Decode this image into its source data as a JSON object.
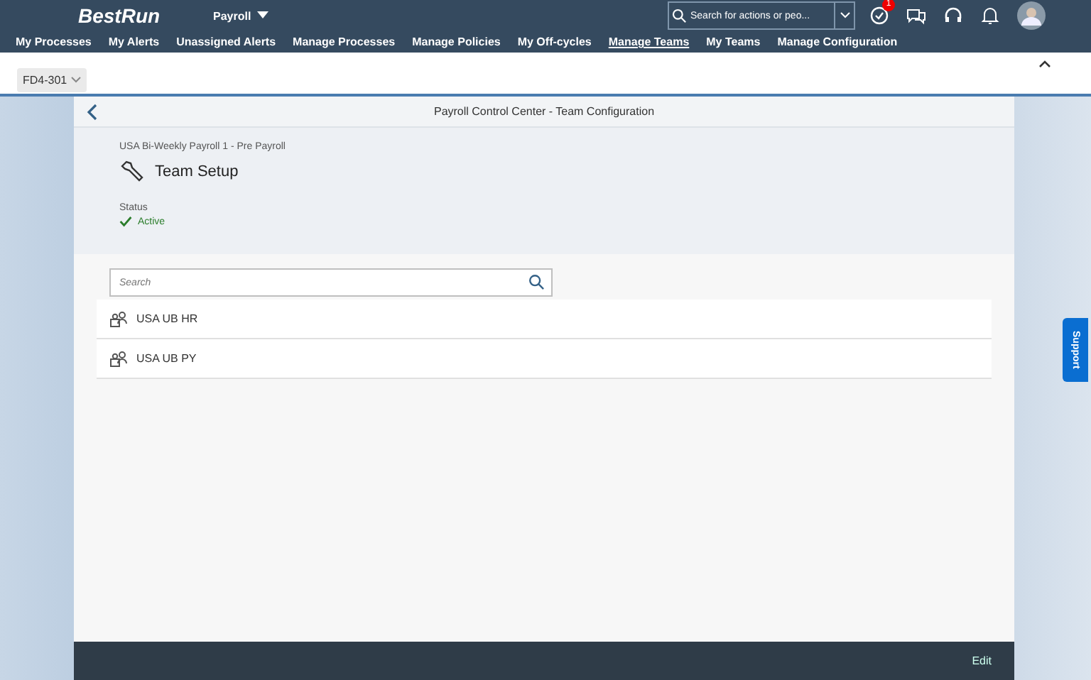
{
  "shell": {
    "logo": "BestRun",
    "app_title": "Payroll",
    "search": {
      "placeholder": "Search for actions or peo..."
    },
    "notification_badge": "1"
  },
  "nav": [
    {
      "label": "My Processes",
      "selected": false
    },
    {
      "label": "My Alerts",
      "selected": false
    },
    {
      "label": "Unassigned Alerts",
      "selected": false
    },
    {
      "label": "Manage Processes",
      "selected": false
    },
    {
      "label": "Manage Policies",
      "selected": false
    },
    {
      "label": "My Off-cycles",
      "selected": false
    },
    {
      "label": "Manage Teams",
      "selected": true
    },
    {
      "label": "My Teams",
      "selected": false
    },
    {
      "label": "Manage Configuration",
      "selected": false
    }
  ],
  "system_selector": "FD4-301",
  "page": {
    "title": "Payroll Control Center - Team Configuration",
    "subtitle": "USA Bi-Weekly Payroll 1 - Pre Payroll",
    "heading": "Team Setup",
    "status_label": "Status",
    "status": "Active"
  },
  "search": {
    "placeholder": "Search"
  },
  "teams": [
    {
      "name": "USA UB HR"
    },
    {
      "name": "USA UB PY"
    }
  ],
  "footer": {
    "edit": "Edit"
  },
  "support": "Support"
}
